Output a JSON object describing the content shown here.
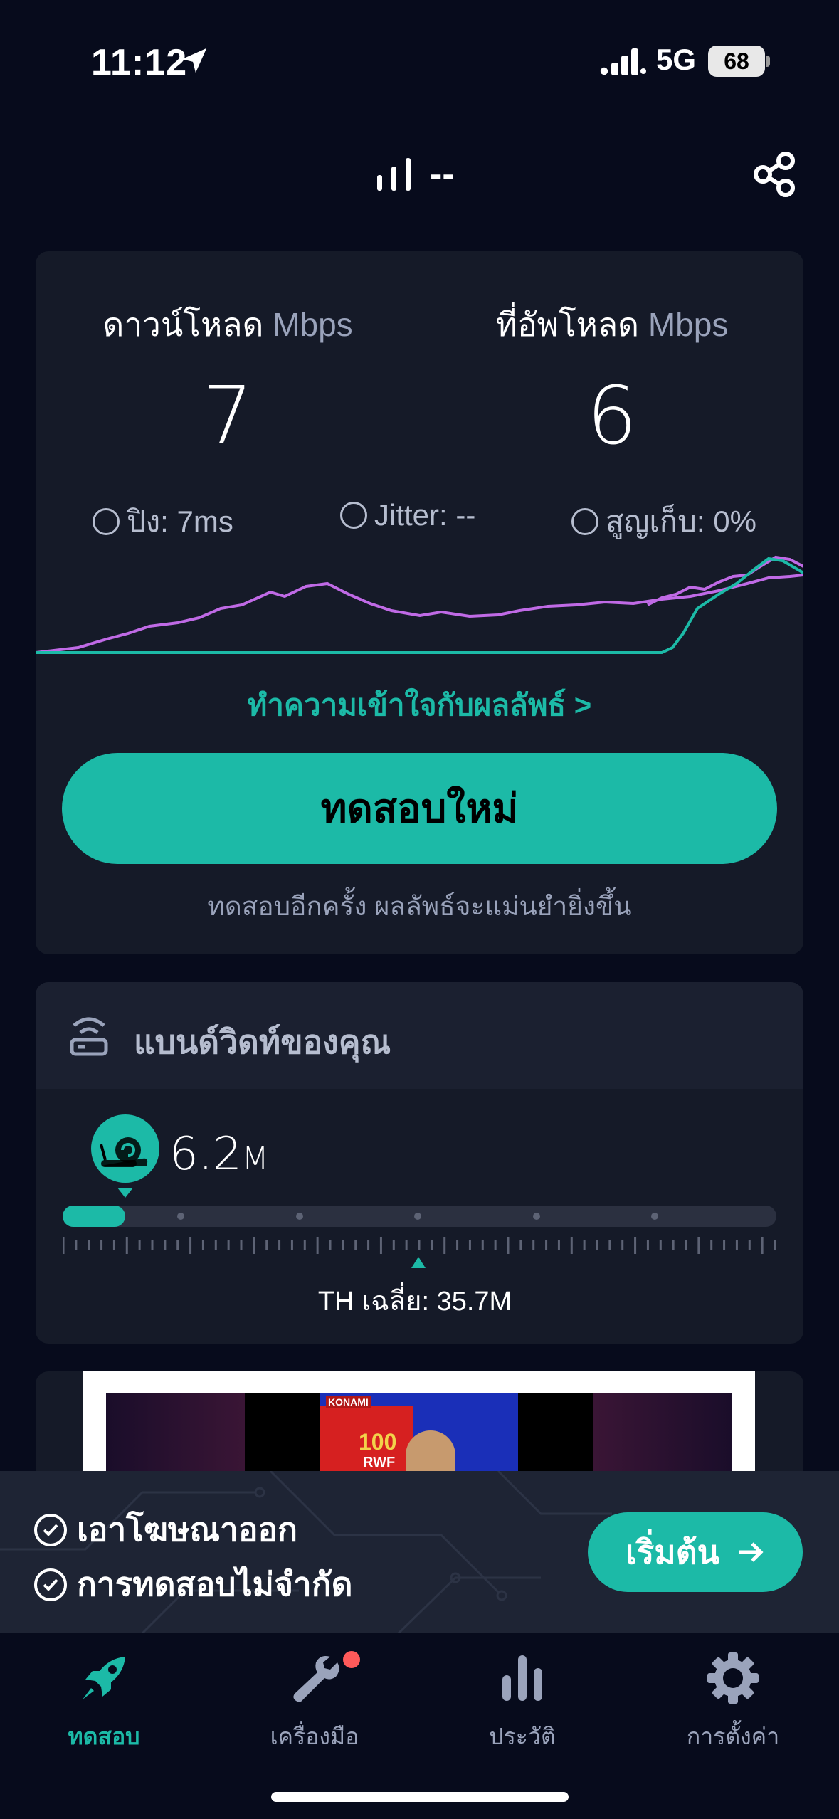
{
  "status_bar": {
    "time": "11:12",
    "network": "5G",
    "battery": "68"
  },
  "header": {
    "connection_text": "--"
  },
  "result": {
    "download_label": "ดาวน์โหลด",
    "download_unit": "Mbps",
    "download_value": "7",
    "upload_label": "ที่อัพโหลด",
    "upload_unit": "Mbps",
    "upload_value": "6",
    "ping": "ปิง: 7ms",
    "jitter": "Jitter: --",
    "loss": "สูญเก็บ: 0%",
    "understand_link": "ทำความเข้าใจกับผลลัพธ์ >",
    "retest_button": "ทดสอบใหม่",
    "retest_hint": "ทดสอบอีกครั้ง ผลลัพธ์จะแม่นยำยิ่งขึ้น",
    "colors": {
      "download_line": "#c06ae6",
      "upload_line": "#1cbaa7"
    }
  },
  "bandwidth": {
    "title": "แบนด์วิดท์ของคุณ",
    "speed_value": "6.2",
    "speed_unit": "M",
    "average": "TH เฉลี่ย: 35.7M"
  },
  "ad": {
    "brand": "KONAMI",
    "rating": "100",
    "position": "RWF"
  },
  "promo": {
    "item1": "เอาโฆษณาออก",
    "item2": "การทดสอบไม่จำกัด",
    "start_button": "เริ่มต้น"
  },
  "tabs": [
    {
      "label": "ทดสอบ",
      "icon": "rocket-icon",
      "active": true
    },
    {
      "label": "เครื่องมือ",
      "icon": "wrench-icon",
      "badge": true
    },
    {
      "label": "ประวัติ",
      "icon": "bar-chart-icon"
    },
    {
      "label": "การตั้งค่า",
      "icon": "gear-icon"
    }
  ],
  "accent_color": "#1cbaa7"
}
